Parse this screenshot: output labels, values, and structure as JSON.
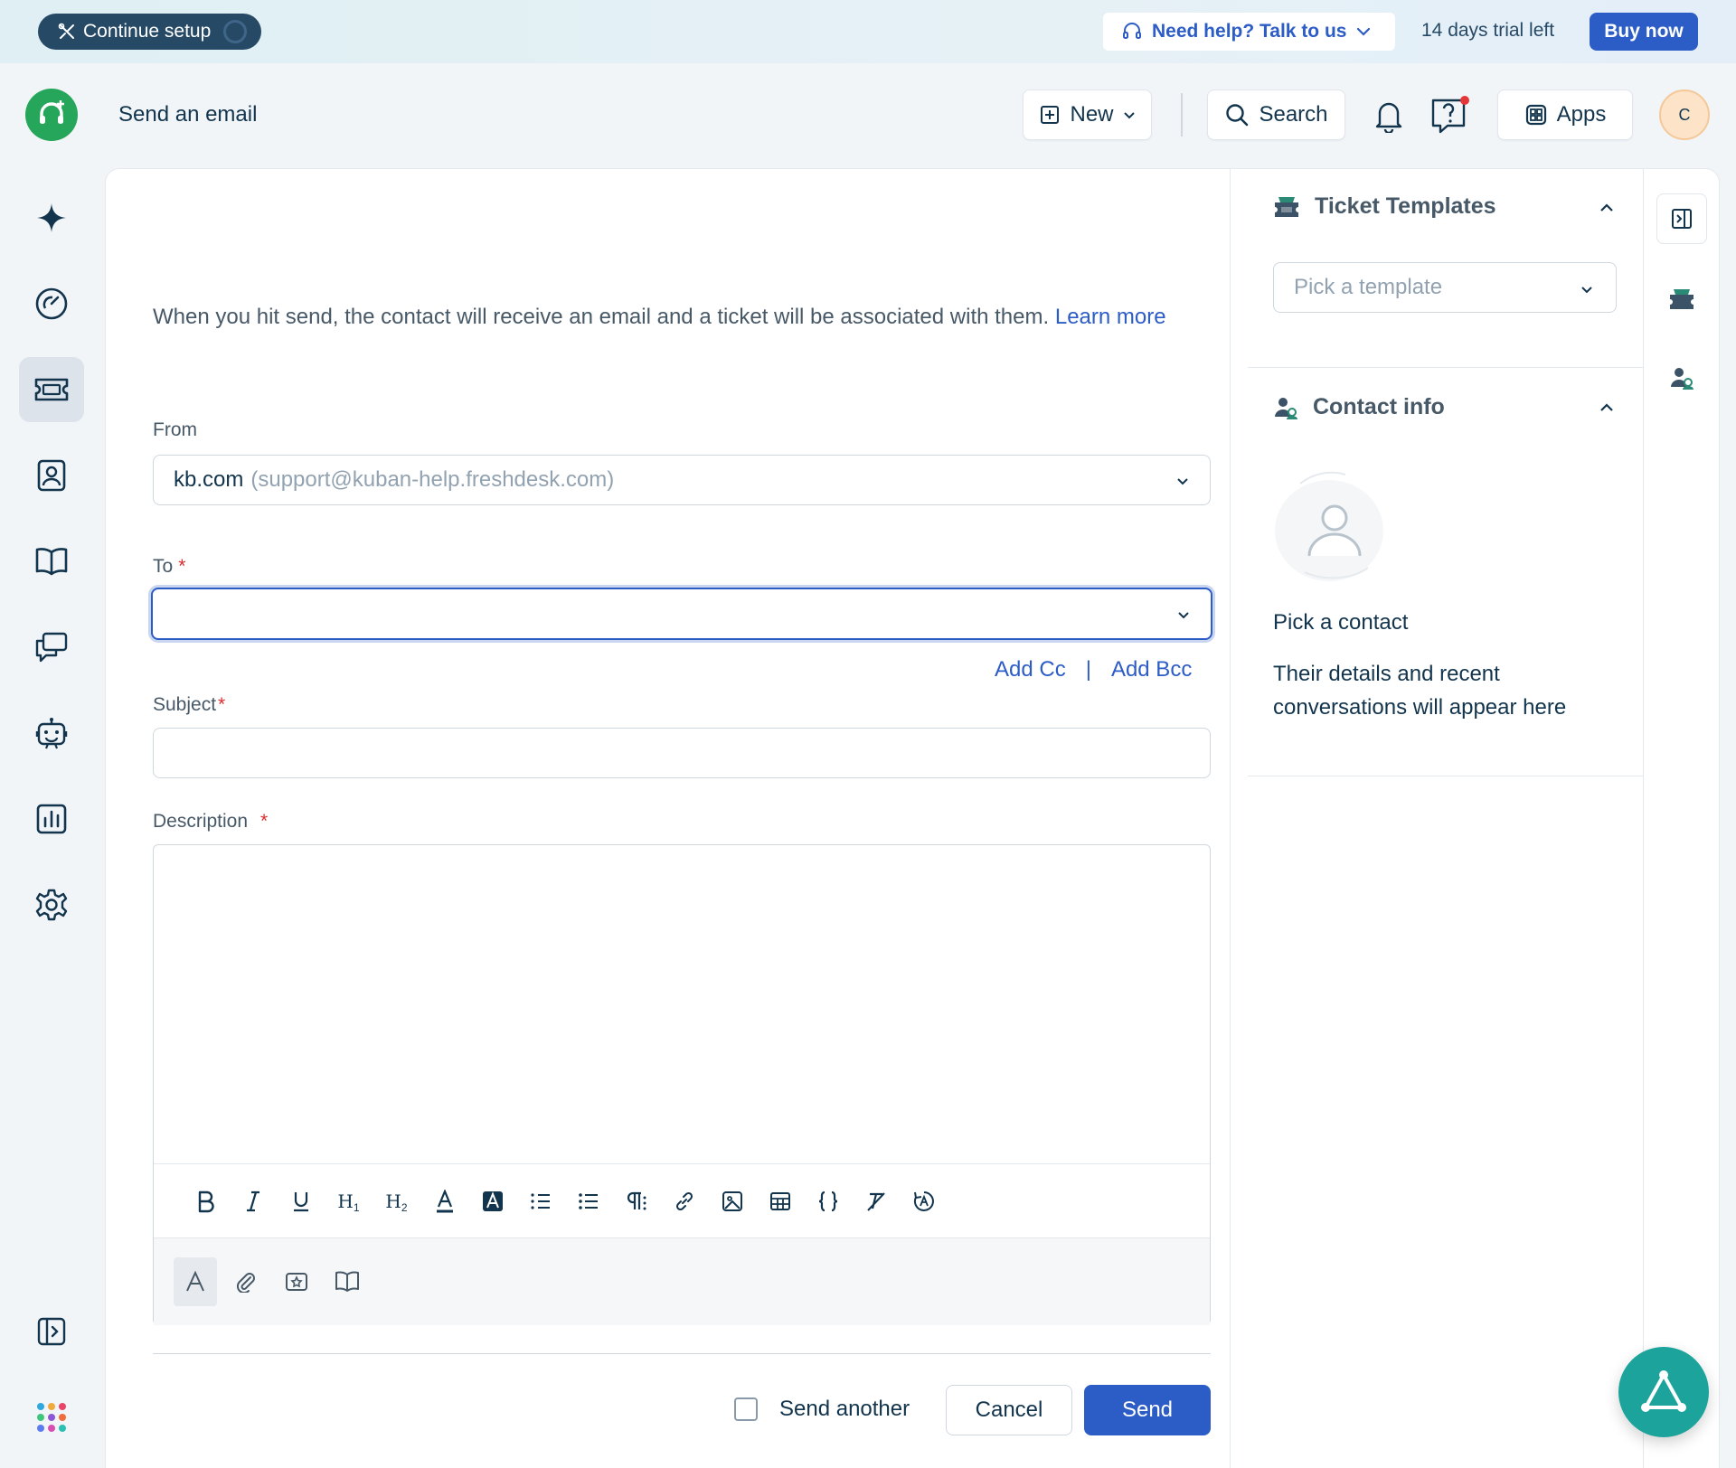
{
  "banner": {
    "continue_setup_label": "Continue setup",
    "help_label": "Need help? Talk to us",
    "trial_text": "14 days trial left",
    "buy_label": "Buy now"
  },
  "header": {
    "page_title": "Send an email",
    "new_label": "New",
    "search_label": "Search",
    "apps_label": "Apps",
    "avatar_initial": "C"
  },
  "sidebar": {
    "items": [
      {
        "icon": "sparkle-icon"
      },
      {
        "icon": "dashboard-icon"
      },
      {
        "icon": "ticket-icon",
        "active": true
      },
      {
        "icon": "contacts-icon"
      },
      {
        "icon": "book-icon"
      },
      {
        "icon": "conversations-icon"
      },
      {
        "icon": "bot-icon"
      },
      {
        "icon": "analytics-icon"
      },
      {
        "icon": "gear-icon"
      }
    ]
  },
  "form": {
    "intro_text": "When you hit send, the contact will receive an email and a ticket will be associated with them.",
    "learn_more": "Learn more",
    "from_label": "From",
    "from_value": "kb.com",
    "from_email": "(support@kuban-help.freshdesk.com)",
    "to_label": "To",
    "to_value": "",
    "required_marker": "*",
    "add_cc": "Add Cc",
    "cc_separator": "|",
    "add_bcc": "Add Bcc",
    "subject_label": "Subject",
    "subject_value": "",
    "description_label": "Description",
    "description_value": "",
    "send_another": "Send another",
    "cancel": "Cancel",
    "send": "Send"
  },
  "toolbar": {
    "h1": "H",
    "h1_sub": "1",
    "h2": "H",
    "h2_sub": "2"
  },
  "right_panel": {
    "templates_title": "Ticket Templates",
    "template_placeholder": "Pick a template",
    "contact_title": "Contact info",
    "pick_contact": "Pick a contact",
    "contact_desc": "Their details and recent conversations will appear here"
  },
  "colors": {
    "primary": "#2c5cc5",
    "brand_green": "#26a65b",
    "fab_teal": "#1ba39c",
    "required": "#d72d30"
  }
}
